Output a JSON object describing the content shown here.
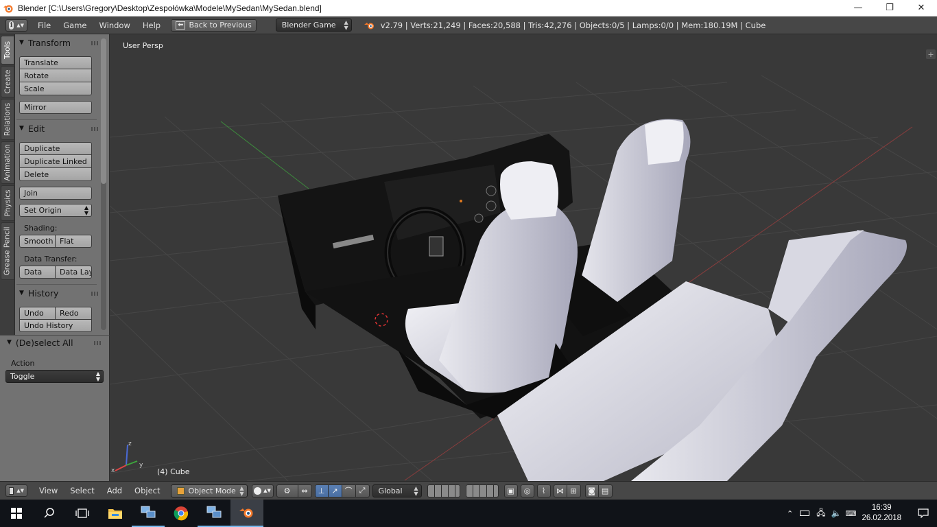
{
  "window": {
    "title": "Blender [C:\\Users\\Gregory\\Desktop\\Zespołówka\\Modele\\MySedan\\MySedan.blend]",
    "minimize_glyph": "—",
    "maximize_glyph": "❐",
    "close_glyph": "✕",
    "icon": "blender-icon"
  },
  "info_header": {
    "editor_type_glyph": "i",
    "menus": [
      "File",
      "Game",
      "Window",
      "Help"
    ],
    "back_button": "Back to Previous",
    "engine": "Blender Game",
    "stats": "v2.79 | Verts:21,249 | Faces:20,588 | Tris:42,276 | Objects:0/5 | Lamps:0/0 | Mem:180.19M | Cube"
  },
  "tool_tabs": [
    "Tools",
    "Create",
    "Relations",
    "Animation",
    "Physics",
    "Grease Pencil"
  ],
  "tool_shelf": {
    "transform": {
      "title": "Transform",
      "buttons": [
        "Translate",
        "Rotate",
        "Scale"
      ],
      "mirror": "Mirror"
    },
    "edit": {
      "title": "Edit",
      "buttons": [
        "Duplicate",
        "Duplicate Linked",
        "Delete"
      ],
      "join": "Join",
      "set_origin": "Set Origin",
      "shading_label": "Shading:",
      "smooth": "Smooth",
      "flat": "Flat",
      "data_transfer_label": "Data Transfer:",
      "data": "Data",
      "data_layers": "Data Lay"
    },
    "history": {
      "title": "History",
      "undo": "Undo",
      "redo": "Redo",
      "undo_history": "Undo History"
    }
  },
  "operator_panel": {
    "title": "(De)select All",
    "action_label": "Action",
    "action_value": "Toggle"
  },
  "viewport": {
    "view_name": "User Persp",
    "object_label": "(4) Cube",
    "axis_x": "x",
    "axis_y": "y",
    "axis_z": "z",
    "plus": "+"
  },
  "view_header": {
    "menus": [
      "View",
      "Select",
      "Add",
      "Object"
    ],
    "mode": "Object Mode",
    "orientation": "Global"
  },
  "taskbar": {
    "time": "16:39",
    "date": "26.02.2018"
  },
  "colors": {
    "accent_blue": "#5a7fb3",
    "shelf_gray": "#727272",
    "viewport_bg": "#393939"
  }
}
